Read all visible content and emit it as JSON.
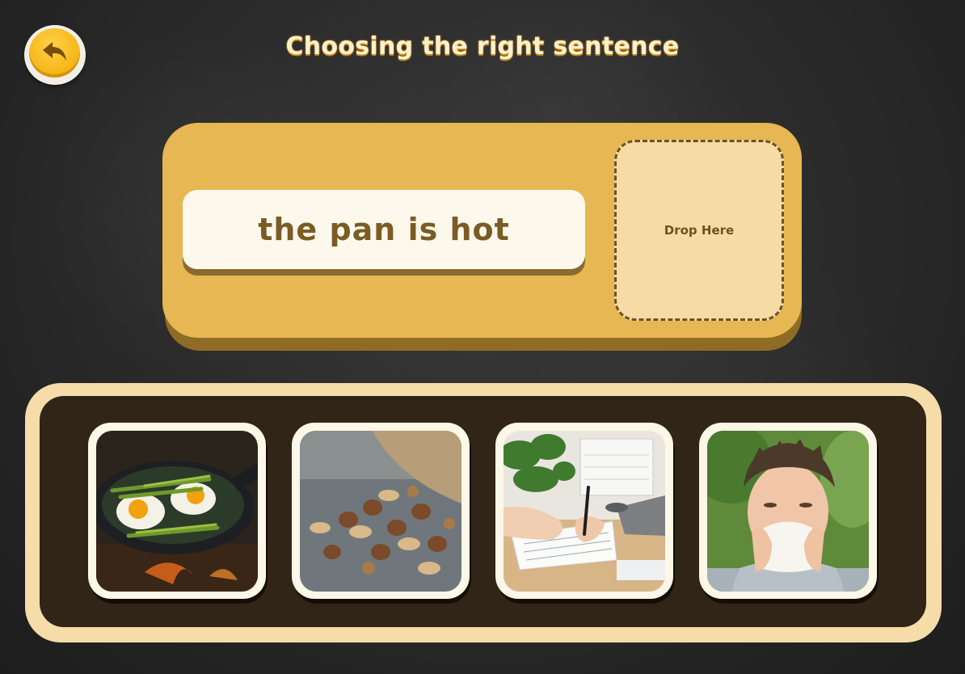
{
  "header": {
    "title": "Choosing the right sentence",
    "back_icon": "back-arrow-icon"
  },
  "sentence_panel": {
    "sentence": "the pan is hot",
    "drop_label": "Drop Here"
  },
  "choices": [
    {
      "picture": "eggs-asparagus-in-pan-picture"
    },
    {
      "picture": "pile-of-nuts-picture"
    },
    {
      "picture": "hands-writing-notebook-picture"
    },
    {
      "picture": "boy-sneezing-tissue-picture"
    }
  ],
  "colors": {
    "panel": "#e6b753",
    "drop_zone": "#f6dca4",
    "tray_border": "#f6dca8",
    "tray_inner": "#302516",
    "text_brown": "#7a5c24",
    "button_orange": "#f5b414"
  }
}
